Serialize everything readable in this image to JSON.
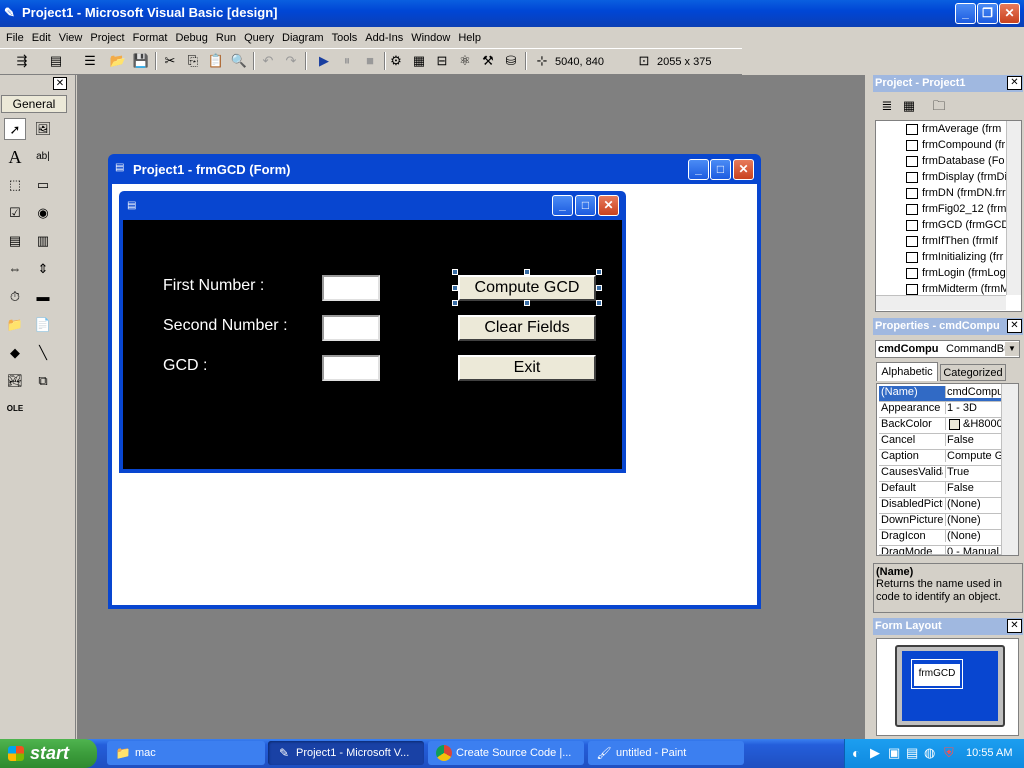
{
  "app": {
    "title": "Project1 - Microsoft Visual Basic [design]"
  },
  "menu": [
    "File",
    "Edit",
    "View",
    "Project",
    "Format",
    "Debug",
    "Run",
    "Query",
    "Diagram",
    "Tools",
    "Add-Ins",
    "Window",
    "Help"
  ],
  "toolbar": {
    "position": "5040, 840",
    "size": "2055 x 375"
  },
  "toolbox": {
    "title": "General"
  },
  "designer": {
    "title": "Project1 - frmGCD (Form)"
  },
  "form": {
    "first_label": "First Number :",
    "second_label": "Second Number :",
    "gcd_label": "GCD :",
    "compute_button": "Compute GCD",
    "clear_button": "Clear Fields",
    "exit_button": "Exit"
  },
  "project": {
    "title": "Project - Project1",
    "items": [
      "frmAverage (frm",
      "frmCompound (fr",
      "frmDatabase (Fo",
      "frmDisplay (frmDi",
      "frmDN (frmDN.frr",
      "frmFig02_12 (frm",
      "frmGCD (frmGCD",
      "frmIfThen (frmIf",
      "frmInitializing (frr",
      "frmLogin (frmLog",
      "frmMidterm (frmM"
    ]
  },
  "properties": {
    "title": "Properties - cmdCompu",
    "object_name": "cmdCompu",
    "object_type": "CommandBu",
    "tab_alpha": "Alphabetic",
    "tab_cat": "Categorized",
    "rows": [
      {
        "k": "(Name)",
        "v": "cmdCompu"
      },
      {
        "k": "Appearance",
        "v": "1 - 3D"
      },
      {
        "k": "BackColor",
        "v": "&H8000"
      },
      {
        "k": "Cancel",
        "v": "False"
      },
      {
        "k": "Caption",
        "v": "Compute G"
      },
      {
        "k": "CausesValida",
        "v": "True"
      },
      {
        "k": "Default",
        "v": "False"
      },
      {
        "k": "DisabledPictu",
        "v": "(None)"
      },
      {
        "k": "DownPicture",
        "v": "(None)"
      },
      {
        "k": "DragIcon",
        "v": "(None)"
      },
      {
        "k": "DragMode",
        "v": "0 - Manual"
      }
    ],
    "desc_title": "(Name)",
    "desc_text": "Returns the name used in code to identify an object."
  },
  "layout": {
    "title": "Form Layout",
    "form_label": "frmGCD"
  },
  "taskbar": {
    "start": "start",
    "tasks": [
      "mac",
      "Project1 - Microsoft V...",
      "Create Source Code |...",
      "untitled - Paint"
    ],
    "clock": "10:55 AM"
  },
  "colors": {
    "xp_blue": "#0a5fe0",
    "desktop_gray": "#808080",
    "form_back": "#000000",
    "taskbar": "#245edb",
    "start_green": "#3c9d3c"
  }
}
